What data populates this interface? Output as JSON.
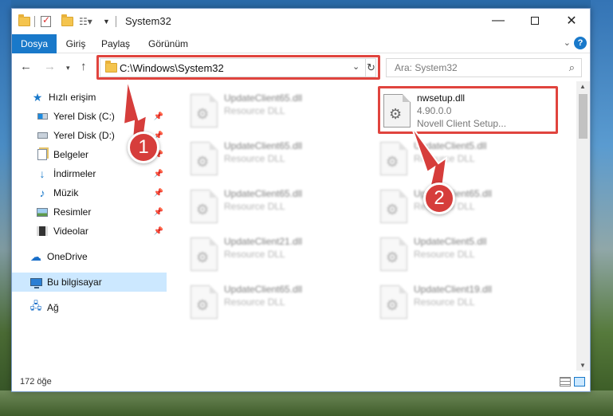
{
  "window": {
    "title": "System32",
    "controls": {
      "minimize": "—",
      "maximize": "",
      "close": "✕"
    }
  },
  "ribbon": {
    "tabs": [
      {
        "label": "Dosya"
      },
      {
        "label": "Giriş"
      },
      {
        "label": "Paylaş"
      },
      {
        "label": "Görünüm"
      }
    ],
    "help": "?"
  },
  "address": {
    "path": "C:\\Windows\\System32",
    "search_placeholder": "Ara: System32"
  },
  "sidebar": {
    "items": [
      {
        "label": "Hızlı erişim",
        "icon": "star-icon"
      },
      {
        "label": "Yerel Disk (C:)",
        "icon": "drive-icon",
        "pinned": true
      },
      {
        "label": "Yerel Disk (D:)",
        "icon": "drive-icon",
        "pinned": true
      },
      {
        "label": "Belgeler",
        "icon": "documents-icon",
        "pinned": true
      },
      {
        "label": "İndirmeler",
        "icon": "downloads-icon",
        "pinned": true
      },
      {
        "label": "Müzik",
        "icon": "music-icon",
        "pinned": true
      },
      {
        "label": "Resimler",
        "icon": "pictures-icon",
        "pinned": true
      },
      {
        "label": "Videolar",
        "icon": "videos-icon",
        "pinned": true
      },
      {
        "label": "OneDrive",
        "icon": "onedrive-icon"
      },
      {
        "label": "Bu bilgisayar",
        "icon": "computer-icon",
        "selected": true
      },
      {
        "label": "Ağ",
        "icon": "network-icon"
      }
    ]
  },
  "files": {
    "highlighted": {
      "name": "nwsetup.dll",
      "version": "4.90.0.0",
      "description": "Novell Client Setup..."
    },
    "left_column": [
      {
        "name": "UpdateClient65.dll",
        "type": "Resource DLL"
      },
      {
        "name": "UpdateClient65.dll",
        "type": "Resource DLL"
      },
      {
        "name": "UpdateClient65.dll",
        "type": "Resource DLL"
      },
      {
        "name": "UpdateClient21.dll",
        "type": "Resource DLL"
      },
      {
        "name": "UpdateClient65.dll",
        "type": "Resource DLL"
      }
    ],
    "right_column": [
      {
        "name": "UpdateClient5.dll",
        "type": "Resource DLL"
      },
      {
        "name": "UpdateClient65.dll",
        "type": "Resource DLL"
      },
      {
        "name": "UpdateClient5.dll",
        "type": "Resource DLL"
      },
      {
        "name": "UpdateClient19.dll",
        "type": "Resource DLL"
      }
    ]
  },
  "status": {
    "item_count": "172 öğe"
  },
  "annotations": {
    "step1": "1",
    "step2": "2",
    "color": "#d63d3b"
  }
}
